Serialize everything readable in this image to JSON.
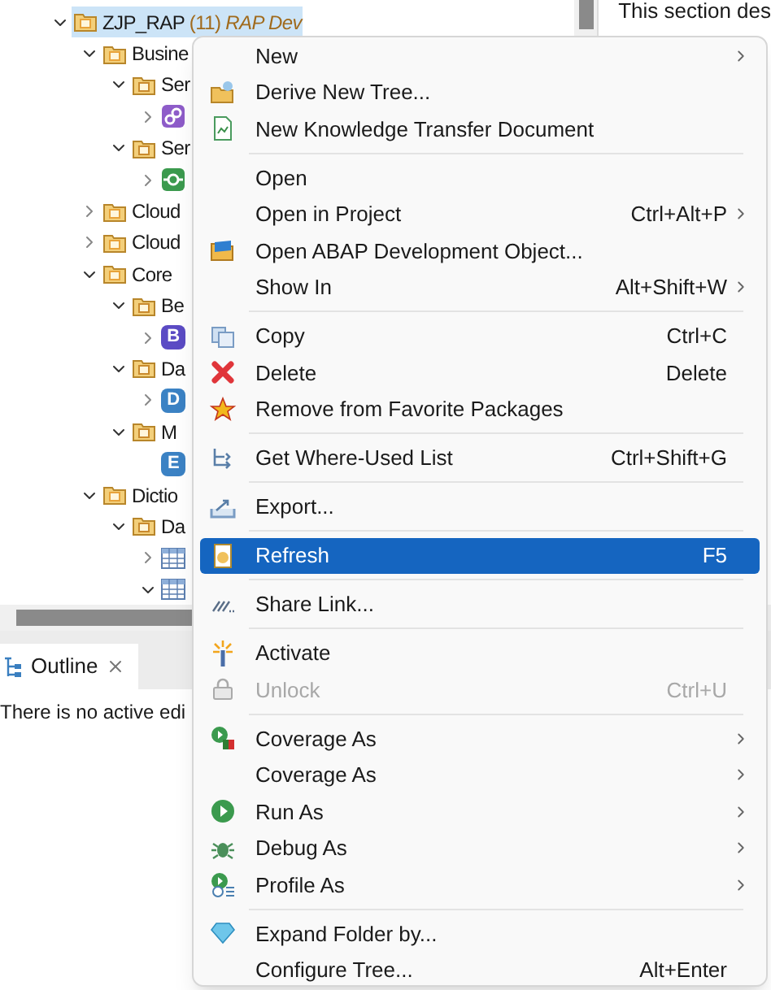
{
  "tree": {
    "nodes": [
      {
        "label": "ZJP_RAP",
        "count": "(11)",
        "description": "RAP Dev",
        "kind": "package",
        "selected": true,
        "expanded": true,
        "children": [
          {
            "label": "Busine",
            "kind": "package",
            "expanded": true,
            "children": [
              {
                "label": "Ser",
                "kind": "subpackage",
                "expanded": true,
                "children": [
                  {
                    "kind": "service-binding",
                    "expanded": false
                  }
                ]
              },
              {
                "label": "Ser",
                "kind": "subpackage",
                "expanded": true,
                "children": [
                  {
                    "kind": "service-definition",
                    "expanded": false
                  }
                ]
              }
            ]
          },
          {
            "label": "Cloud",
            "kind": "package",
            "expanded": false
          },
          {
            "label": "Cloud",
            "kind": "package",
            "expanded": false
          },
          {
            "label": "Core",
            "kind": "package",
            "expanded": true,
            "children": [
              {
                "label": "Be",
                "kind": "subpackage",
                "expanded": true,
                "children": [
                  {
                    "kind": "letter",
                    "badge": "B",
                    "color": "#5b4bc4",
                    "expanded": false
                  }
                ]
              },
              {
                "label": "Da",
                "kind": "subpackage",
                "expanded": true,
                "children": [
                  {
                    "kind": "letter",
                    "badge": "D",
                    "color": "#3b82c4",
                    "expanded": false
                  }
                ]
              },
              {
                "label": "M",
                "kind": "subpackage",
                "expanded": true,
                "children": [
                  {
                    "kind": "letter",
                    "badge": "E",
                    "color": "#3b82c4"
                  }
                ]
              }
            ]
          },
          {
            "label": "Dictio",
            "kind": "package",
            "expanded": true,
            "children": [
              {
                "label": "Da",
                "kind": "subpackage",
                "expanded": true,
                "children": [
                  {
                    "kind": "table",
                    "expanded": false
                  },
                  {
                    "kind": "table",
                    "expanded": true
                  }
                ]
              }
            ]
          }
        ]
      }
    ]
  },
  "right_panel": {
    "text": "This section des"
  },
  "outline": {
    "tab": "Outline",
    "message": "There is no active edi"
  },
  "context_menu": {
    "items": [
      {
        "kind": "item",
        "label": "New",
        "submenu": true,
        "selected": false,
        "disabled": false
      },
      {
        "kind": "item",
        "label": "Derive New Tree...",
        "submenu": false,
        "selected": false,
        "disabled": false
      },
      {
        "kind": "item",
        "label": "New Knowledge Transfer Document",
        "submenu": false,
        "selected": false,
        "disabled": false
      },
      {
        "kind": "separator"
      },
      {
        "kind": "item",
        "label": "Open",
        "submenu": false,
        "selected": false,
        "disabled": false
      },
      {
        "kind": "item",
        "label": "Open in Project",
        "shortcut": "Ctrl+Alt+P",
        "submenu": true,
        "selected": false,
        "disabled": false
      },
      {
        "kind": "item",
        "label": "Open ABAP Development Object...",
        "submenu": false,
        "selected": false,
        "disabled": false
      },
      {
        "kind": "item",
        "label": "Show In",
        "shortcut": "Alt+Shift+W",
        "submenu": true,
        "selected": false,
        "disabled": false
      },
      {
        "kind": "separator"
      },
      {
        "kind": "item",
        "label": "Copy",
        "shortcut": "Ctrl+C",
        "submenu": false,
        "selected": false,
        "disabled": false
      },
      {
        "kind": "item",
        "label": "Delete",
        "shortcut": "Delete",
        "submenu": false,
        "selected": false,
        "disabled": false
      },
      {
        "kind": "item",
        "label": "Remove from Favorite Packages",
        "submenu": false,
        "selected": false,
        "disabled": false
      },
      {
        "kind": "separator"
      },
      {
        "kind": "item",
        "label": "Get Where-Used List",
        "shortcut": "Ctrl+Shift+G",
        "submenu": false,
        "selected": false,
        "disabled": false
      },
      {
        "kind": "separator"
      },
      {
        "kind": "item",
        "label": "Export...",
        "submenu": false,
        "selected": false,
        "disabled": false
      },
      {
        "kind": "separator"
      },
      {
        "kind": "item",
        "label": "Refresh",
        "shortcut": "F5",
        "submenu": false,
        "selected": true,
        "disabled": false
      },
      {
        "kind": "separator"
      },
      {
        "kind": "item",
        "label": "Share Link...",
        "submenu": false,
        "selected": false,
        "disabled": false
      },
      {
        "kind": "separator"
      },
      {
        "kind": "item",
        "label": "Activate",
        "submenu": false,
        "selected": false,
        "disabled": false
      },
      {
        "kind": "item",
        "label": "Unlock",
        "shortcut": "Ctrl+U",
        "submenu": false,
        "selected": false,
        "disabled": true
      },
      {
        "kind": "separator"
      },
      {
        "kind": "item",
        "label": "Coverage As",
        "submenu": true,
        "selected": false,
        "disabled": false
      },
      {
        "kind": "item",
        "label": "Coverage As",
        "submenu": true,
        "selected": false,
        "disabled": false
      },
      {
        "kind": "item",
        "label": "Run As",
        "submenu": true,
        "selected": false,
        "disabled": false
      },
      {
        "kind": "item",
        "label": "Debug As",
        "submenu": true,
        "selected": false,
        "disabled": false
      },
      {
        "kind": "item",
        "label": "Profile As",
        "submenu": true,
        "selected": false,
        "disabled": false
      },
      {
        "kind": "separator"
      },
      {
        "kind": "item",
        "label": "Expand Folder by...",
        "submenu": false,
        "selected": false,
        "disabled": false
      },
      {
        "kind": "item",
        "label": "Configure Tree...",
        "shortcut": "Alt+Enter",
        "submenu": false,
        "selected": false,
        "disabled": false
      }
    ]
  }
}
